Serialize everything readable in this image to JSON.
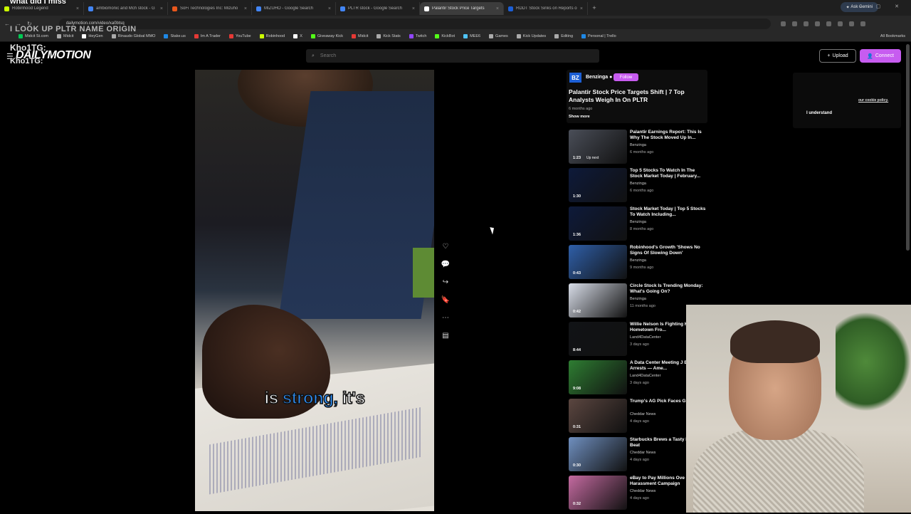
{
  "browser": {
    "tabs": [
      {
        "label": "Robinhood Legend",
        "color": "#ccff00",
        "active": false
      },
      {
        "label": "ambiomonic and Mch stock - G",
        "color": "#4285f4",
        "active": false
      },
      {
        "label": "SoFi Technologies Inc: Mizuho",
        "color": "#e8571c",
        "active": false
      },
      {
        "label": "MIZUHO - Google Search",
        "color": "#4285f4",
        "active": false
      },
      {
        "label": "PLTR stock - Google Search",
        "color": "#4285f4",
        "active": false
      },
      {
        "label": "Palantir Stock Price Targets",
        "color": "#ffffff",
        "active": true
      },
      {
        "label": "RDDT Stock Sinks on Reports o",
        "color": "#1c5fd6",
        "active": false
      }
    ],
    "gemini_label": "Ask Gemini",
    "url": "dailymotion.com/video/xa0btsq",
    "bookmarks": [
      {
        "label": "Midcit St.com",
        "color": "#00c853"
      },
      {
        "label": "Midcit",
        "color": "#aaaaaa"
      },
      {
        "label": "HeyGen",
        "color": "#ffffff"
      },
      {
        "label": "Rinaudo Global MMO",
        "color": "#aaaaaa"
      },
      {
        "label": "Stake.us",
        "color": "#1e88e5"
      },
      {
        "label": "Im A Trader",
        "color": "#e53935"
      },
      {
        "label": "YouTube",
        "color": "#e53935"
      },
      {
        "label": "Robinhood",
        "color": "#ccff00"
      },
      {
        "label": "X",
        "color": "#ffffff"
      },
      {
        "label": "Giveaway Kick",
        "color": "#53fc18"
      },
      {
        "label": "Midcit",
        "color": "#e53935"
      },
      {
        "label": "Kick Stats",
        "color": "#aaaaaa"
      },
      {
        "label": "Twitch",
        "color": "#9146ff"
      },
      {
        "label": "KickBot",
        "color": "#53fc18"
      },
      {
        "label": "MEE6",
        "color": "#4fc3f7"
      },
      {
        "label": "Games",
        "color": "#aaaaaa"
      },
      {
        "label": "Kick Updates",
        "color": "#aaaaaa"
      },
      {
        "label": "Editing",
        "color": "#aaaaaa"
      },
      {
        "label": "Personal | Trello",
        "color": "#1e88e5"
      }
    ],
    "all_bookmarks": "All Bookmarks"
  },
  "stream_overlay": {
    "question": "what did I miss",
    "subject": "I LOOK UP PLTR NAME ORIGIN",
    "handle1": "Kho1TG:",
    "handle2": "Kho1TG:"
  },
  "header": {
    "logo": "DAILYMOTION",
    "search_placeholder": "Search",
    "upload_label": "Upload",
    "connect_label": "Connect"
  },
  "video": {
    "caption_pre": "is ",
    "caption_hl": "strong,",
    "caption_post": " it's"
  },
  "info": {
    "channel_logo": "BZ",
    "channel": "Benzinga",
    "follow_label": "Follow",
    "title": "Palantir Stock Price Targets Shift | 7 Top Analysts Weigh In On PLTR",
    "age": "6 months ago",
    "show_more": "Show more"
  },
  "up_next_label": "Up next",
  "playlist": [
    {
      "title": "Palantir Earnings Report: This Is Why The Stock Moved Up In...",
      "channel": "Benzinga",
      "age": "6 months ago",
      "duration": "1:23",
      "thumb": "#4a4e58"
    },
    {
      "title": "Top 5 Stocks To Watch In The Stock Market Today | February...",
      "channel": "Benzinga",
      "age": "6 months ago",
      "duration": "1:30",
      "thumb": "#0e1a3a"
    },
    {
      "title": "Stock Market Today | Top 5 Stocks To Watch Including...",
      "channel": "Benzinga",
      "age": "8 months ago",
      "duration": "1:36",
      "thumb": "#0e1a3a"
    },
    {
      "title": "Robinhood's Growth 'Shows No Signs Of Slowing Down'",
      "channel": "Benzinga",
      "age": "9 months ago",
      "duration": "0:43",
      "thumb": "#2f5fa8"
    },
    {
      "title": "Circle Stock Is Trending Monday: What's Going On?",
      "channel": "Benzinga",
      "age": "11 months ago",
      "duration": "0:42",
      "thumb": "#d8dde8"
    },
    {
      "title": "Willie Nelson Is Fighting His Texas Hometown Fro...",
      "channel": "Land4DataCenter",
      "age": "3 days ago",
      "duration": "8:44",
      "thumb": "#111316"
    },
    {
      "title": "A Data Center Meeting J Ended In Arrests — Ame...",
      "channel": "Land4DataCenter",
      "age": "3 days ago",
      "duration": "9:08",
      "thumb": "#2e7d32"
    },
    {
      "title": "Trump's AG Pick Faces G Scrutiny",
      "channel": "Cheddar News",
      "age": "4 days ago",
      "duration": "0:31",
      "thumb": "#5b4640"
    },
    {
      "title": "Starbucks Brews a Tasty Earnings Beat",
      "channel": "Cheddar News",
      "age": "4 days ago",
      "duration": "0:30",
      "thumb": "#6f8fbf"
    },
    {
      "title": "eBay to Pay Millions Ove Harassment Campaign",
      "channel": "Cheddar News",
      "age": "4 days ago",
      "duration": "0:32",
      "thumb": "#c46aa0"
    }
  ],
  "cookie": {
    "link": "our cookie policy.",
    "button": "I understand"
  }
}
